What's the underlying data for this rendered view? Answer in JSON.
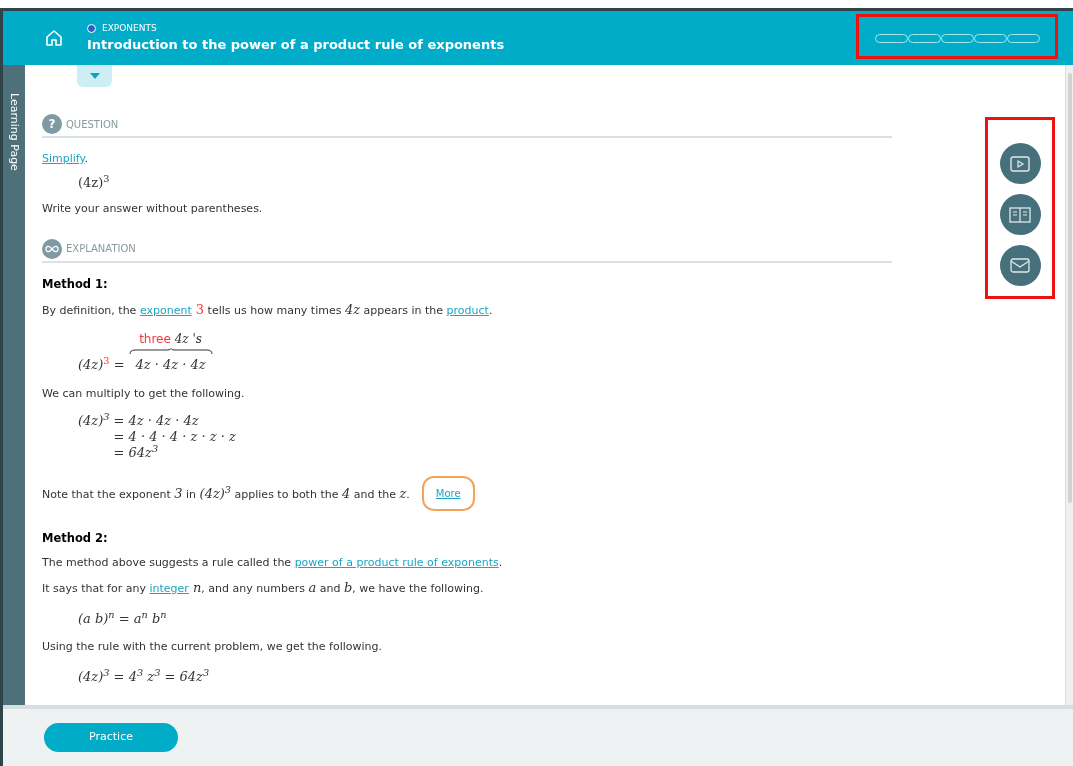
{
  "header": {
    "category": "EXPONENTS",
    "title": "Introduction to the power of a product rule of exponents",
    "progress": [
      {
        "filled": false
      },
      {
        "filled": false
      },
      {
        "filled": false
      },
      {
        "filled": false
      },
      {
        "filled": false
      }
    ]
  },
  "details_toggle": {
    "expanded": false
  },
  "side_tab": {
    "label": "Learning Page"
  },
  "question": {
    "icon": "?",
    "heading": "QUESTION",
    "prompt": [
      {
        "kind": "link",
        "text": "Simplify"
      },
      {
        "kind": "text",
        "text": "."
      }
    ],
    "expression": "(4z)$^{3}$",
    "note": "Write your answer without parentheses."
  },
  "explanation": {
    "heading": "EXPLANATION",
    "blocks": [
      {
        "kind": "heading",
        "text": "Method 1:"
      },
      {
        "kind": "paragraph",
        "segments": [
          {
            "kind": "text",
            "text": "By definition, the "
          },
          {
            "kind": "link",
            "text": "exponent"
          },
          {
            "kind": "red",
            "text": " 3"
          },
          {
            "kind": "text",
            "text": " tells us how many times "
          },
          {
            "kind": "math",
            "text": "4z"
          },
          {
            "kind": "text",
            "text": " appears in the "
          },
          {
            "kind": "link",
            "text": "product"
          },
          {
            "kind": "text",
            "text": "."
          }
        ]
      },
      {
        "kind": "brace",
        "base": "(4z)",
        "exponent": "3",
        "equals": "=",
        "label_red": "three",
        "label_rest": "4z 's",
        "body": "4z · 4z · 4z"
      },
      {
        "kind": "paragraph",
        "segments": [
          {
            "kind": "text",
            "text": "We can multiply to get the following."
          }
        ]
      },
      {
        "kind": "aligned",
        "lhs": "(4z)$^{3}$",
        "rows": [
          "= 4z · 4z · 4z",
          "= 4 · 4 · 4 · z · z · z",
          "= 64z$^{3}$"
        ]
      },
      {
        "kind": "note",
        "segments": [
          {
            "kind": "text",
            "text": "Note that the exponent "
          },
          {
            "kind": "math",
            "text": "3"
          },
          {
            "kind": "text",
            "text": " in "
          },
          {
            "kind": "math",
            "text": "(4z)$^{3}$"
          },
          {
            "kind": "text",
            "text": " applies to both the "
          },
          {
            "kind": "math",
            "text": "4"
          },
          {
            "kind": "text",
            "text": " and the "
          },
          {
            "kind": "math",
            "text": "z"
          },
          {
            "kind": "text",
            "text": "."
          }
        ],
        "button": "More"
      },
      {
        "kind": "heading",
        "text": "Method 2:"
      },
      {
        "kind": "paragraph",
        "segments": [
          {
            "kind": "text",
            "text": "The method above suggests a rule called the "
          },
          {
            "kind": "link",
            "text": "power of a product rule of exponents"
          },
          {
            "kind": "text",
            "text": "."
          }
        ]
      },
      {
        "kind": "paragraph",
        "segments": [
          {
            "kind": "text",
            "text": "It says that for any "
          },
          {
            "kind": "link",
            "text": "integer"
          },
          {
            "kind": "math",
            "text": " n"
          },
          {
            "kind": "text",
            "text": ", and any numbers "
          },
          {
            "kind": "math",
            "text": "a"
          },
          {
            "kind": "text",
            "text": " and "
          },
          {
            "kind": "math",
            "text": "b"
          },
          {
            "kind": "text",
            "text": ", we have the following."
          }
        ]
      },
      {
        "kind": "math",
        "text": "(a b)$^{n}$ = a$^{n}$ b$^{n}$"
      },
      {
        "kind": "paragraph",
        "segments": [
          {
            "kind": "text",
            "text": "Using the rule with the current problem, we get the following."
          }
        ]
      },
      {
        "kind": "math",
        "text": "(4z)$^{3}$ = 4$^{3}$ z$^{3}$ = 64z$^{3}$"
      }
    ]
  },
  "footer": {
    "button": "Practice"
  }
}
